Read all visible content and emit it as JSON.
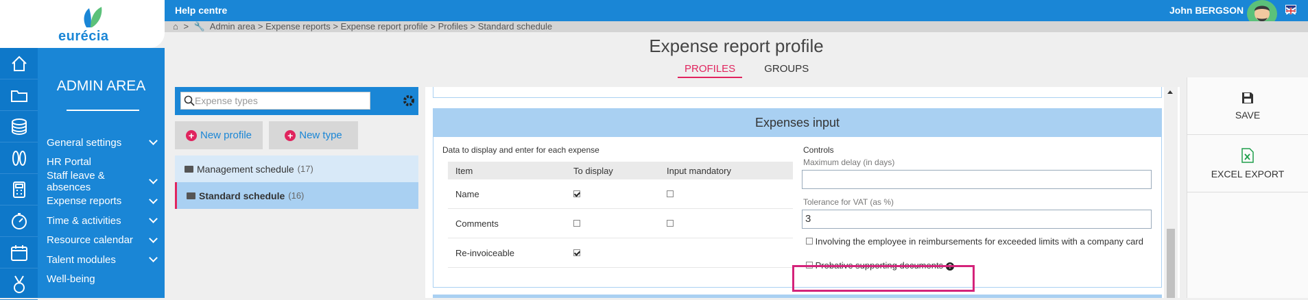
{
  "logo": {
    "word": "eurécia"
  },
  "topbar": {
    "help": "Help centre",
    "user": "John  BERGSON"
  },
  "breadcrumb": {
    "home": "⌂",
    "sep": ">",
    "path": "Admin area > Expense reports > Expense report profile >  Profiles  > Standard schedule"
  },
  "menu": {
    "title": "ADMIN AREA",
    "items": [
      {
        "label": "General settings",
        "chevron": true
      },
      {
        "label": "HR Portal",
        "chevron": false
      },
      {
        "label": "Staff leave & absences",
        "chevron": true
      },
      {
        "label": "Expense reports",
        "chevron": true
      },
      {
        "label": "Time & activities",
        "chevron": true
      },
      {
        "label": "Resource calendar",
        "chevron": true
      },
      {
        "label": "Talent modules",
        "chevron": true
      },
      {
        "label": "Well-being",
        "chevron": false
      }
    ]
  },
  "page": {
    "title": "Expense report profile",
    "tabs": [
      "PROFILES",
      "GROUPS"
    ]
  },
  "left_panel": {
    "search_placeholder": "Expense types",
    "new_profile": "New profile",
    "new_type": "New type",
    "profiles": [
      {
        "name": "Management schedule",
        "count": "(17)"
      },
      {
        "name": "Standard schedule",
        "count": "(16)"
      }
    ]
  },
  "form": {
    "section_title": "Expenses input",
    "data_caption": "Data to display and enter for each expense",
    "controls_caption": "Controls",
    "columns": [
      "Item",
      "To display",
      "Input mandatory"
    ],
    "rows": [
      {
        "item": "Name",
        "display": true,
        "mandatory": false
      },
      {
        "item": "Comments",
        "display": false,
        "mandatory": false
      },
      {
        "item": "Re-invoiceable",
        "display": true,
        "mandatory": false
      }
    ],
    "max_delay_label": "Maximum delay (in days)",
    "max_delay_value": "",
    "vat_label": "Tolerance for VAT (as %)",
    "vat_value": "3",
    "involve_label": "Involving the employee in reimbursements for exceeded limits with a company card",
    "probative_label": "Probative supporting documents",
    "help_mark": "?"
  },
  "actions": {
    "save": "SAVE",
    "export": "EXCEL EXPORT"
  },
  "colors": {
    "primary": "#1a86d6",
    "accent": "#e0245e",
    "section": "#a9d0f2",
    "highlight": "#d4237a"
  }
}
